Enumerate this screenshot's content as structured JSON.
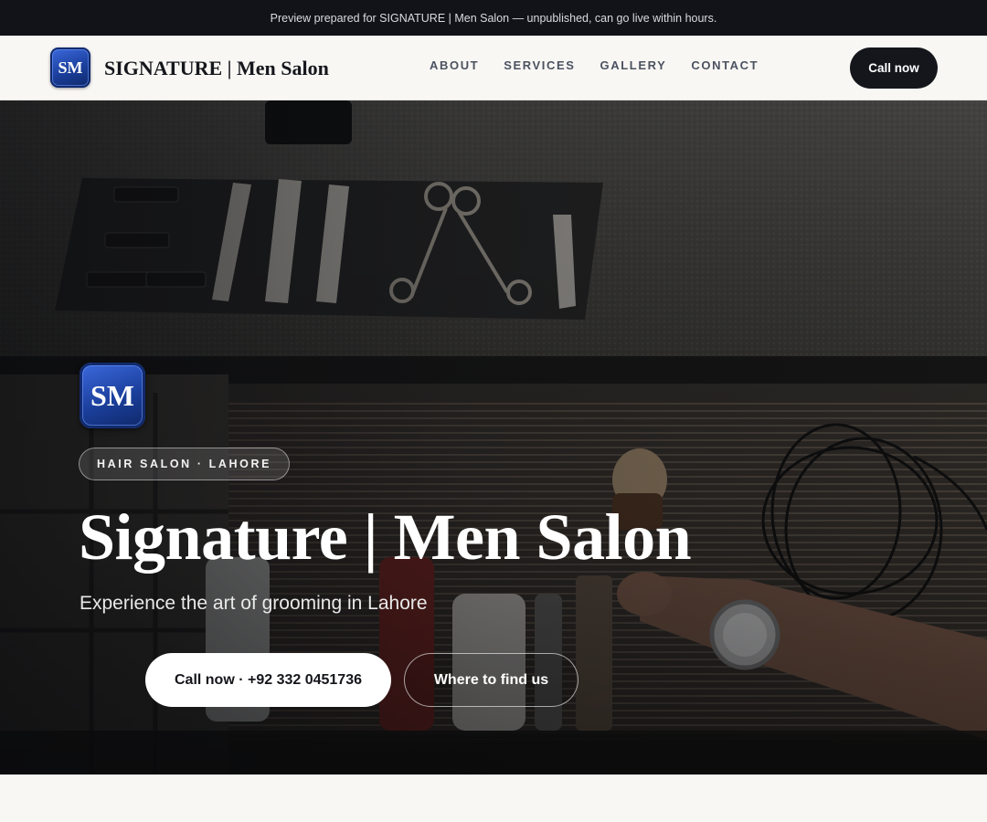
{
  "preview_banner": {
    "text": "Preview prepared for SIGNATURE | Men Salon — unpublished, can go live within hours."
  },
  "header": {
    "logo_initials": "SM",
    "brand_name": "SIGNATURE | Men Salon",
    "nav": [
      {
        "label": "ABOUT"
      },
      {
        "label": "SERVICES"
      },
      {
        "label": "GALLERY"
      },
      {
        "label": "CONTACT"
      }
    ],
    "cta_label": "Call now"
  },
  "hero": {
    "logo_initials": "SM",
    "tagline": "HAIR SALON · LAHORE",
    "title": "Signature | Men Salon",
    "subtitle": "Experience the art of grooming in Lahore",
    "primary_button": "Call now · +92 332 0451736",
    "secondary_button": "Where to find us"
  },
  "colors": {
    "dark": "#14161b",
    "logo_blue": "#1b3f9c",
    "page_background": "#f8f7f4"
  }
}
